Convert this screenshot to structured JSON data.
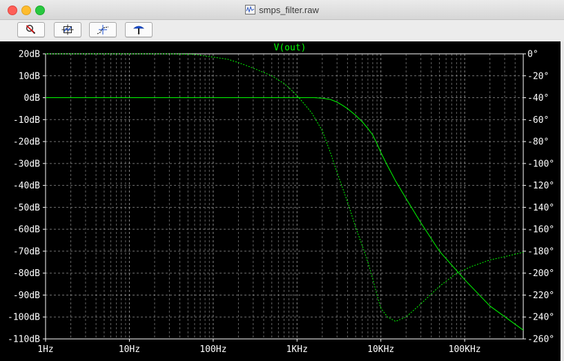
{
  "window": {
    "title": "smps_filter.raw",
    "title_icon": "waveform-document-icon"
  },
  "toolbar": {
    "buttons": [
      {
        "name": "zoom-cancel-button",
        "icon": "zoom-cancel-icon"
      },
      {
        "name": "autorange-button",
        "icon": "autorange-icon"
      },
      {
        "name": "cursor-button",
        "icon": "cursor-icon"
      },
      {
        "name": "probe-button",
        "icon": "probe-icon"
      }
    ]
  },
  "colors": {
    "background": "#000000",
    "trace": "#00ff00",
    "grid": "#9a9a9a",
    "axis_text": "#ffffff",
    "trace_label": "#00ff00"
  },
  "chart_data": {
    "type": "line",
    "title": "",
    "trace_label": "V(out)",
    "x_scale": "log",
    "xlim": [
      1,
      500000
    ],
    "x_ticks": [
      1,
      10,
      100,
      1000,
      10000,
      100000
    ],
    "x_tick_labels": [
      "1Hz",
      "10Hz",
      "100Hz",
      "1KHz",
      "10KHz",
      "100KHz"
    ],
    "ylim_left": [
      -110,
      20
    ],
    "y_ticks_left": [
      20,
      10,
      0,
      -10,
      -20,
      -30,
      -40,
      -50,
      -60,
      -70,
      -80,
      -90,
      -100,
      -110
    ],
    "y_tick_labels_left": [
      "20dB",
      "10dB",
      "0dB",
      "-10dB",
      "-20dB",
      "-30dB",
      "-40dB",
      "-50dB",
      "-60dB",
      "-70dB",
      "-80dB",
      "-90dB",
      "-100dB",
      "-110dB"
    ],
    "ylim_right": [
      -260,
      0
    ],
    "y_ticks_right": [
      0,
      -20,
      -40,
      -60,
      -80,
      -100,
      -120,
      -140,
      -160,
      -180,
      -200,
      -220,
      -240,
      -260
    ],
    "y_tick_labels_right": [
      "0°",
      "-20°",
      "-40°",
      "-60°",
      "-80°",
      "-100°",
      "-120°",
      "-140°",
      "-160°",
      "-180°",
      "-200°",
      "-220°",
      "-240°",
      "-260°"
    ],
    "grid": true,
    "series": [
      {
        "axis": "left",
        "style": "solid",
        "points": [
          [
            1,
            0
          ],
          [
            100,
            0
          ],
          [
            1000,
            0
          ],
          [
            1600,
            0
          ],
          [
            2000,
            -0.2
          ],
          [
            2500,
            -0.8
          ],
          [
            3000,
            -2
          ],
          [
            3500,
            -3.5
          ],
          [
            4000,
            -5
          ],
          [
            5000,
            -8
          ],
          [
            6000,
            -11
          ],
          [
            7000,
            -14
          ],
          [
            8000,
            -17
          ],
          [
            9000,
            -21
          ],
          [
            10000,
            -25
          ],
          [
            12000,
            -31
          ],
          [
            15000,
            -38
          ],
          [
            20000,
            -46
          ],
          [
            30000,
            -57
          ],
          [
            50000,
            -70
          ],
          [
            100000,
            -83
          ],
          [
            200000,
            -95
          ],
          [
            500000,
            -106
          ]
        ]
      },
      {
        "axis": "right",
        "style": "dashed",
        "points": [
          [
            1,
            0
          ],
          [
            10,
            0
          ],
          [
            30,
            0
          ],
          [
            60,
            -0.5
          ],
          [
            100,
            -3
          ],
          [
            150,
            -5
          ],
          [
            200,
            -8
          ],
          [
            300,
            -13
          ],
          [
            400,
            -17
          ],
          [
            500,
            -20
          ],
          [
            600,
            -24
          ],
          [
            700,
            -27
          ],
          [
            800,
            -31
          ],
          [
            1000,
            -38
          ],
          [
            1200,
            -45
          ],
          [
            1500,
            -54
          ],
          [
            2000,
            -70
          ],
          [
            2500,
            -90
          ],
          [
            3000,
            -108
          ],
          [
            4000,
            -135
          ],
          [
            5000,
            -158
          ],
          [
            6000,
            -175
          ],
          [
            7000,
            -190
          ],
          [
            8000,
            -205
          ],
          [
            9000,
            -220
          ],
          [
            10000,
            -232
          ],
          [
            12000,
            -240
          ],
          [
            15000,
            -244
          ],
          [
            20000,
            -240
          ],
          [
            30000,
            -228
          ],
          [
            50000,
            -212
          ],
          [
            80000,
            -200
          ],
          [
            120000,
            -194
          ],
          [
            200000,
            -188
          ],
          [
            300000,
            -185
          ],
          [
            500000,
            -181
          ]
        ]
      }
    ]
  }
}
